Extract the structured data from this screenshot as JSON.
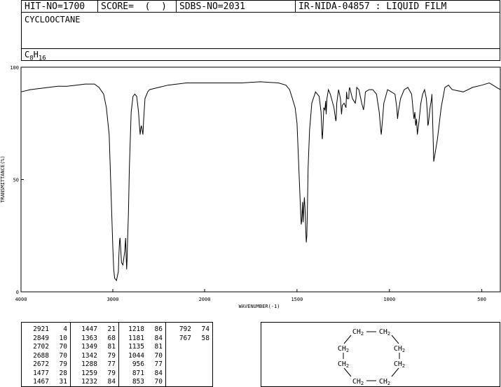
{
  "header": {
    "hit_no": "HIT-NO=1700",
    "score": "SCORE=  (  )",
    "sdbs_no": "SDBS-NO=2031",
    "method": "IR-NIDA-04857 : LIQUID FILM"
  },
  "compound": {
    "name": "CYCLOOCTANE",
    "formula_c": "C",
    "formula_c_sub": "8",
    "formula_h": "H",
    "formula_h_sub": "16"
  },
  "chart_data": {
    "type": "line",
    "title": "",
    "xlabel": "WAVENUMBER(-1)",
    "ylabel": "TRANSMITTANCE(%)",
    "xlim": [
      4000,
      400
    ],
    "ylim": [
      0,
      100
    ],
    "x_ticks": [
      4000,
      3000,
      2000,
      1500,
      1000,
      500
    ],
    "x_tick_labels": [
      "4000",
      "3000",
      "2000",
      "1500",
      "1000",
      "500"
    ],
    "y_ticks": [
      0,
      50,
      100
    ],
    "y_tick_labels": [
      "0",
      "50",
      "100"
    ],
    "grid": false,
    "x": [
      4000,
      3900,
      3800,
      3700,
      3600,
      3500,
      3400,
      3300,
      3200,
      3150,
      3100,
      3070,
      3040,
      3020,
      3000,
      2990,
      2980,
      2960,
      2940,
      2935,
      2930,
      2925,
      2921,
      2915,
      2905,
      2890,
      2870,
      2860,
      2855,
      2849,
      2845,
      2840,
      2830,
      2820,
      2800,
      2780,
      2760,
      2740,
      2720,
      2710,
      2702,
      2695,
      2688,
      2680,
      2672,
      2665,
      2650,
      2620,
      2600,
      2500,
      2400,
      2300,
      2200,
      2100,
      2000,
      1900,
      1800,
      1700,
      1600,
      1560,
      1540,
      1525,
      1510,
      1500,
      1495,
      1490,
      1485,
      1480,
      1477,
      1474,
      1470,
      1467,
      1463,
      1460,
      1456,
      1453,
      1450,
      1447,
      1444,
      1440,
      1432,
      1420,
      1400,
      1380,
      1370,
      1365,
      1363,
      1360,
      1355,
      1349,
      1345,
      1342,
      1338,
      1330,
      1320,
      1300,
      1290,
      1288,
      1285,
      1275,
      1265,
      1259,
      1255,
      1245,
      1235,
      1232,
      1228,
      1220,
      1218,
      1215,
      1200,
      1185,
      1181,
      1177,
      1165,
      1150,
      1140,
      1135,
      1130,
      1110,
      1090,
      1070,
      1055,
      1048,
      1044,
      1040,
      1030,
      1010,
      990,
      970,
      960,
      956,
      952,
      940,
      920,
      900,
      880,
      875,
      871,
      867,
      862,
      858,
      853,
      849,
      840,
      830,
      820,
      810,
      800,
      795,
      792,
      789,
      780,
      772,
      770,
      767,
      764,
      760,
      740,
      720,
      700,
      680,
      660,
      600,
      550,
      500,
      460,
      440,
      420,
      400
    ],
    "y": [
      89,
      90,
      90.5,
      91,
      91.5,
      91.5,
      92,
      92.5,
      92.5,
      91,
      88,
      82,
      70,
      45,
      20,
      10,
      6,
      5,
      9,
      15,
      20,
      23,
      24,
      20,
      13,
      12,
      18,
      24,
      16,
      10,
      14,
      22,
      35,
      55,
      80,
      87,
      88,
      87,
      80,
      74,
      70,
      73,
      74,
      72,
      70,
      76,
      86,
      89,
      90,
      91,
      92,
      92.5,
      93,
      93,
      93,
      93,
      93,
      93.5,
      93,
      92,
      90,
      86,
      82,
      75,
      65,
      55,
      45,
      35,
      30,
      32,
      40,
      31,
      38,
      42,
      36,
      28,
      22,
      25,
      35,
      55,
      72,
      84,
      89,
      87,
      80,
      70,
      68,
      72,
      82,
      81,
      85,
      79,
      86,
      90,
      88,
      82,
      76,
      77,
      84,
      90,
      86,
      79,
      83,
      84,
      82,
      89,
      86,
      86,
      90,
      91,
      86,
      84,
      86,
      91,
      90,
      84,
      81,
      84,
      89,
      90,
      90,
      88,
      80,
      73,
      70,
      74,
      84,
      90,
      89,
      88,
      82,
      77,
      80,
      86,
      90,
      91,
      88,
      84,
      80,
      77,
      80,
      74,
      77,
      70,
      76,
      84,
      88,
      90,
      86,
      80,
      74,
      75,
      82,
      86,
      88,
      79,
      70,
      58,
      68,
      82,
      91,
      92,
      90,
      89,
      91,
      92,
      93,
      92,
      91,
      90,
      88,
      85,
      81
    ],
    "peak_labels": [
      {
        "x": 2921,
        "label": "2921"
      },
      {
        "x": 2849,
        "label": "2849"
      },
      {
        "x": 1477,
        "label": "1477"
      },
      {
        "x": 1447,
        "label": "1447"
      }
    ]
  },
  "peak_table": [
    [
      [
        "2921",
        "4"
      ],
      [
        "2849",
        "10"
      ],
      [
        "2702",
        "70"
      ],
      [
        "2688",
        "70"
      ],
      [
        "2672",
        "79"
      ],
      [
        "1477",
        "28"
      ],
      [
        "1467",
        "31"
      ]
    ],
    [
      [
        "1447",
        "21"
      ],
      [
        "1363",
        "68"
      ],
      [
        "1349",
        "81"
      ],
      [
        "1342",
        "79"
      ],
      [
        "1288",
        "77"
      ],
      [
        "1259",
        "79"
      ],
      [
        "1232",
        "84"
      ]
    ],
    [
      [
        "1218",
        "86"
      ],
      [
        "1181",
        "84"
      ],
      [
        "1135",
        "81"
      ],
      [
        "1044",
        "70"
      ],
      [
        "956",
        "77"
      ],
      [
        "871",
        "84"
      ],
      [
        "853",
        "70"
      ]
    ],
    [
      [
        "792",
        "74"
      ],
      [
        "767",
        "58"
      ]
    ]
  ],
  "structure": {
    "group": "CH",
    "sub": "2"
  }
}
